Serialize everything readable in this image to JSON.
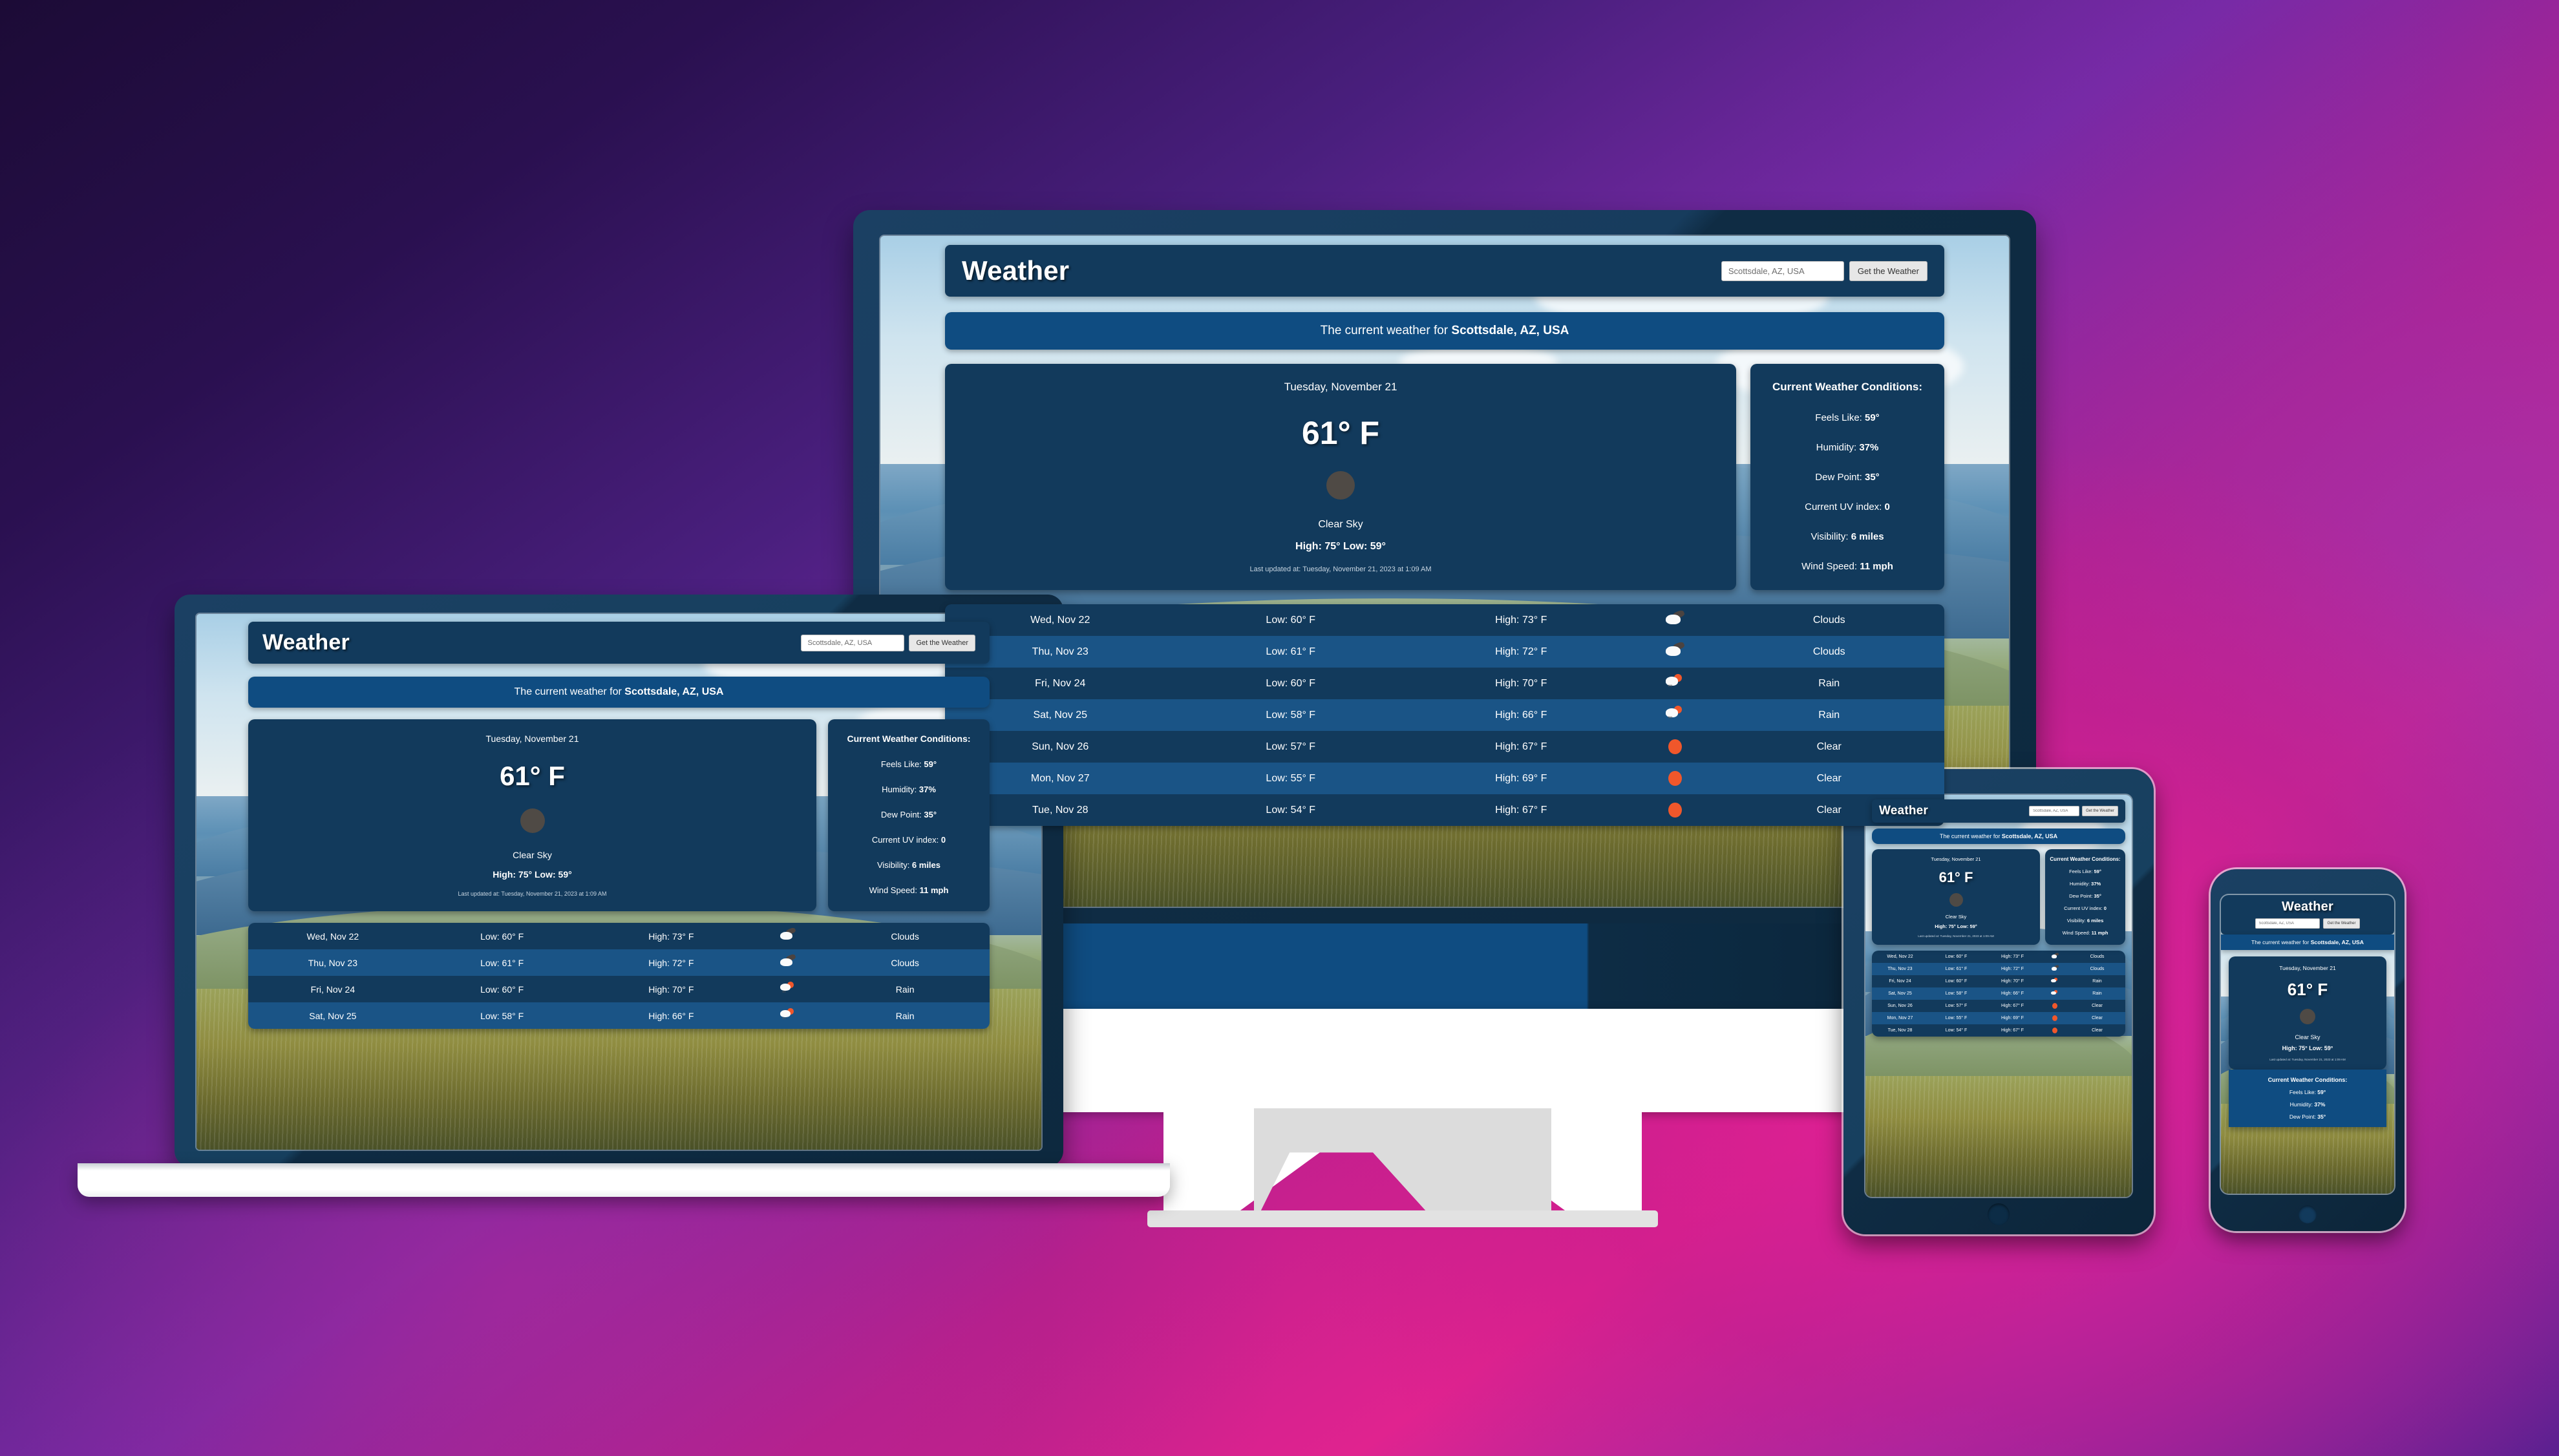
{
  "app": {
    "brand": "Weather",
    "search": {
      "value": "Scottsdale, AZ, USA",
      "placeholder": "Scottsdale, AZ, USA",
      "button_label": "Get the Weather"
    },
    "banner": {
      "prefix": "The current weather for ",
      "location": "Scottsdale, AZ, USA"
    },
    "current": {
      "date": "Tuesday, November 21",
      "temperature": "61° F",
      "icon": "clear-sky-icon",
      "description": "Clear Sky",
      "high_low": "High: 75° Low: 59°",
      "updated": "Last updated at: Tuesday, November 21, 2023 at 1:09 AM"
    },
    "conditions": {
      "title": "Current Weather Conditions:",
      "rows": [
        {
          "label": "Feels Like: ",
          "value": "59°"
        },
        {
          "label": "Humidity: ",
          "value": "37%"
        },
        {
          "label": "Dew Point: ",
          "value": "35°"
        },
        {
          "label": "Current UV index: ",
          "value": "0"
        },
        {
          "label": "Visibility: ",
          "value": "6 miles"
        },
        {
          "label": "Wind Speed: ",
          "value": "11 mph"
        }
      ]
    },
    "forecast": [
      {
        "day": "Wed, Nov 22",
        "low": "Low: 60° F",
        "high": "High: 73° F",
        "icon": "clouds-icon",
        "desc": "Clouds"
      },
      {
        "day": "Thu, Nov 23",
        "low": "Low: 61° F",
        "high": "High: 72° F",
        "icon": "clouds-icon",
        "desc": "Clouds"
      },
      {
        "day": "Fri, Nov 24",
        "low": "Low: 60° F",
        "high": "High: 70° F",
        "icon": "rain-icon",
        "desc": "Rain"
      },
      {
        "day": "Sat, Nov 25",
        "low": "Low: 58° F",
        "high": "High: 66° F",
        "icon": "rain-icon",
        "desc": "Rain"
      },
      {
        "day": "Sun, Nov 26",
        "low": "Low: 57° F",
        "high": "High: 67° F",
        "icon": "sun-icon",
        "desc": "Clear"
      },
      {
        "day": "Mon, Nov 27",
        "low": "Low: 55° F",
        "high": "High: 69° F",
        "icon": "sun-icon",
        "desc": "Clear"
      },
      {
        "day": "Tue, Nov 28",
        "low": "Low: 54° F",
        "high": "High: 67° F",
        "icon": "sun-icon",
        "desc": "Clear"
      }
    ]
  },
  "devices": {
    "desktop": {
      "name": "desktop-monitor",
      "rows_visible": 7
    },
    "laptop": {
      "name": "laptop",
      "rows_visible": 4
    },
    "tablet": {
      "name": "tablet",
      "rows_visible": 7
    },
    "phone": {
      "name": "phone",
      "rows_visible": 0
    }
  },
  "colors": {
    "topbar": "#123a5c",
    "banner": "#0f4c81",
    "card": "#123a5c",
    "row_alt": "#1a5486",
    "sun": "#f0572b",
    "bg_purple": "#2a1050",
    "bg_magenta": "#e0238f"
  }
}
